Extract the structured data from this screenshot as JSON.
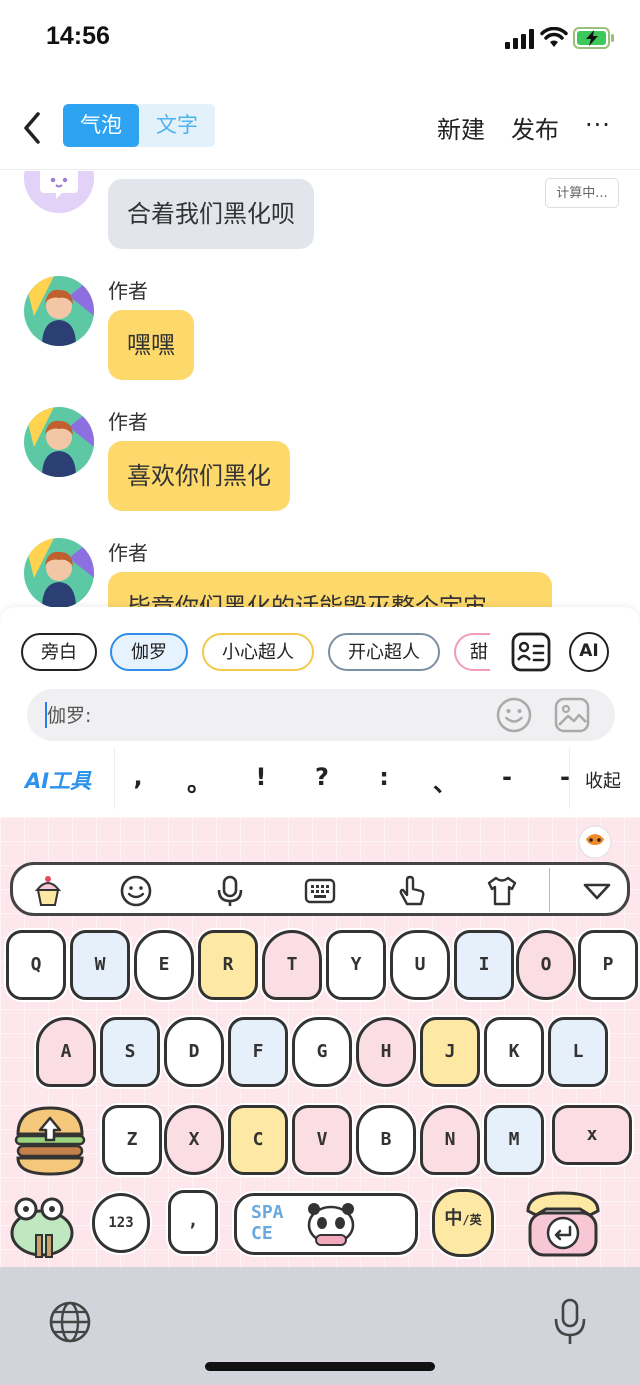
{
  "status_bar": {
    "time": "14:56"
  },
  "nav": {
    "tabs": [
      {
        "label": "气泡",
        "active": true
      },
      {
        "label": "文字",
        "active": false
      }
    ],
    "new_label": "新建",
    "publish_label": "发布",
    "more_label": "···"
  },
  "chat": {
    "calculating_tag": "计算中...",
    "messages": [
      {
        "author": "",
        "text": "合着我们黑化呗",
        "color": "grey"
      },
      {
        "author": "作者",
        "text": "嘿嘿",
        "color": "yellow"
      },
      {
        "author": "作者",
        "text": "喜欢你们黑化",
        "color": "yellow"
      },
      {
        "author": "作者",
        "text": "毕竟你们黑化的话能毁灭整个宇宙",
        "color": "yellow"
      }
    ]
  },
  "panel": {
    "chips": [
      {
        "label": "旁白",
        "color": "#222222",
        "selected": false
      },
      {
        "label": "伽罗",
        "color": "#2f8fe8",
        "selected": true
      },
      {
        "label": "小心超人",
        "color": "#f3c84b",
        "selected": false
      },
      {
        "label": "开心超人",
        "color": "#7d8fa3",
        "selected": false
      },
      {
        "label": "甜",
        "color": "#f29bb5",
        "selected": false
      }
    ],
    "ai_label": "AI",
    "input_prefix": "伽罗:",
    "ai_tools_label": "AI工具",
    "punctuation": [
      ",",
      "。",
      "!",
      "?",
      ":",
      "、",
      "-",
      "-"
    ],
    "collapse_label": "收起"
  },
  "keyboard": {
    "rows": [
      [
        "Q",
        "W",
        "E",
        "R",
        "T",
        "Y",
        "U",
        "I",
        "O",
        "P"
      ],
      [
        "A",
        "S",
        "D",
        "F",
        "G",
        "H",
        "J",
        "K",
        "L"
      ],
      [
        "Z",
        "X",
        "C",
        "V",
        "B",
        "N",
        "M"
      ]
    ],
    "delete_label": "x",
    "num_label": "123",
    "comma_label": ",",
    "space_label_1": "SPA",
    "space_label_2": "CE",
    "lang_label_1": "中",
    "lang_label_2": "/英"
  },
  "colors": {
    "accent": "#2ea3f2",
    "bubble_yellow": "#fdd86a",
    "bubble_grey": "#e2e6ec",
    "keyboard_bg": "#fde7ec"
  }
}
